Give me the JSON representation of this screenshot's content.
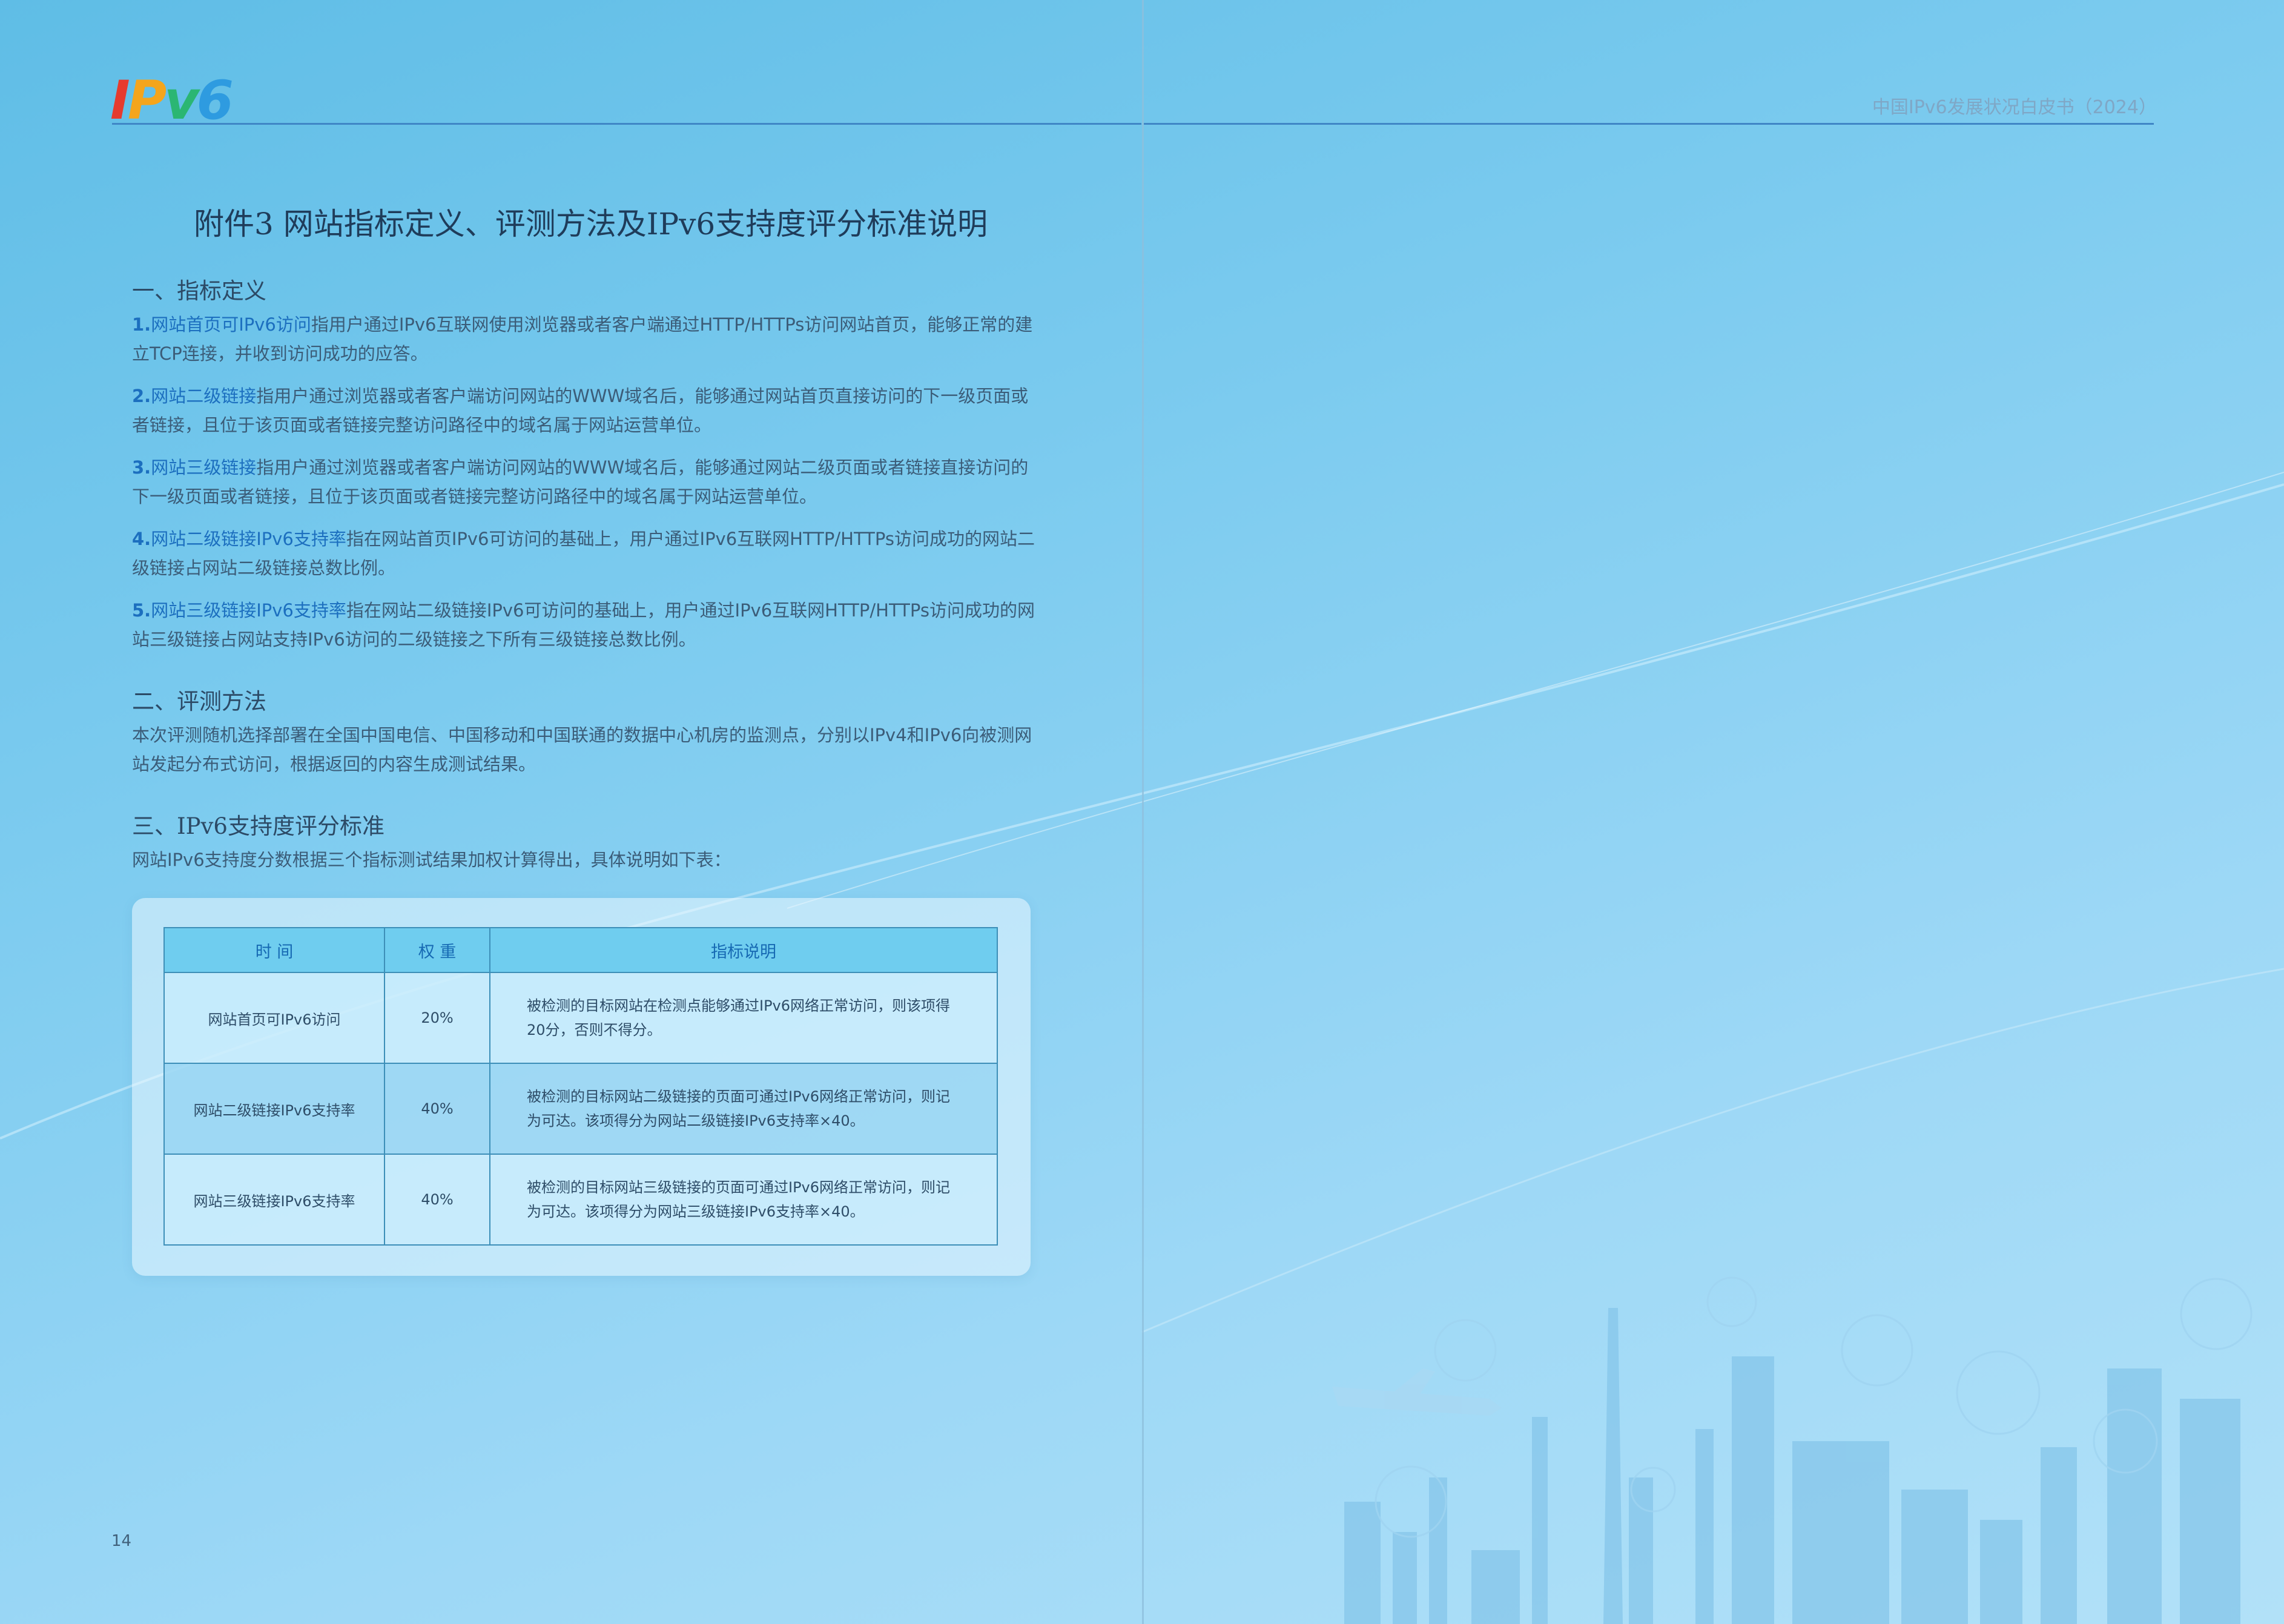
{
  "header": {
    "logo_text": "IPv6",
    "running_head": "中国IPv6发展状况白皮书（2024）"
  },
  "title": "附件3 网站指标定义、评测方法及IPv6支持度评分标准说明",
  "section1": {
    "heading": "一、指标定义",
    "items": [
      {
        "num": "1.",
        "term": "网站首页可IPv6访问",
        "text": "指用户通过IPv6互联网使用浏览器或者客户端通过HTTP/HTTPs访问网站首页，能够正常的建立TCP连接，并收到访问成功的应答。"
      },
      {
        "num": "2.",
        "term": "网站二级链接",
        "text": "指用户通过浏览器或者客户端访问网站的WWW域名后，能够通过网站首页直接访问的下一级页面或者链接，且位于该页面或者链接完整访问路径中的域名属于网站运营单位。"
      },
      {
        "num": "3.",
        "term": "网站三级链接",
        "text": "指用户通过浏览器或者客户端访问网站的WWW域名后，能够通过网站二级页面或者链接直接访问的下一级页面或者链接，且位于该页面或者链接完整访问路径中的域名属于网站运营单位。"
      },
      {
        "num": "4.",
        "term": "网站二级链接IPv6支持率",
        "text": "指在网站首页IPv6可访问的基础上，用户通过IPv6互联网HTTP/HTTPs访问成功的网站二级链接占网站二级链接总数比例。"
      },
      {
        "num": "5.",
        "term": "网站三级链接IPv6支持率",
        "text": "指在网站二级链接IPv6可访问的基础上，用户通过IPv6互联网HTTP/HTTPs访问成功的网站三级链接占网站支持IPv6访问的二级链接之下所有三级链接总数比例。"
      }
    ]
  },
  "section2": {
    "heading": "二、评测方法",
    "text": "本次评测随机选择部署在全国中国电信、中国移动和中国联通的数据中心机房的监测点，分别以IPv4和IPv6向被测网站发起分布式访问，根据返回的内容生成测试结果。"
  },
  "section3": {
    "heading": "三、IPv6支持度评分标准",
    "text": "网站IPv6支持度分数根据三个指标测试结果加权计算得出，具体说明如下表："
  },
  "table": {
    "headers": [
      "时 间",
      "权 重",
      "指标说明"
    ],
    "rows": [
      [
        "网站首页可IPv6访问",
        "20%",
        "被检测的目标网站在检测点能够通过IPv6网络正常访问，则该项得20分，否则不得分。"
      ],
      [
        "网站二级链接IPv6支持率",
        "40%",
        "被检测的目标网站二级链接的页面可通过IPv6网络正常访问，则记为可达。该项得分为网站二级链接IPv6支持率×40。"
      ],
      [
        "网站三级链接IPv6支持率",
        "40%",
        "被检测的目标网站三级链接的页面可通过IPv6网络正常访问，则记为可达。该项得分为网站三级链接IPv6支持率×40。"
      ]
    ]
  },
  "page_number": "14",
  "colors": {
    "accent": "#1c6fbf",
    "header_fill": "#6fcdef",
    "border": "#3d8fb8"
  }
}
